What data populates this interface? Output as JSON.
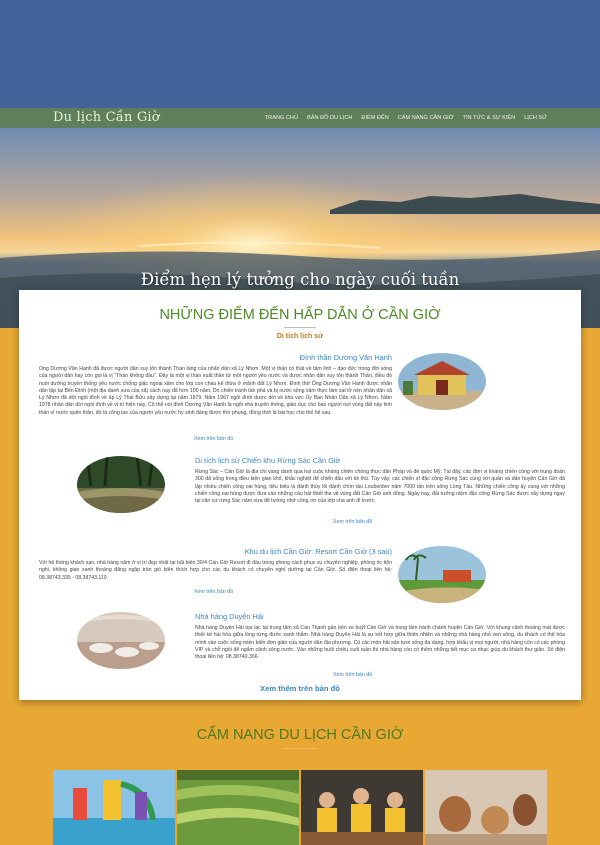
{
  "site": {
    "logo": "Du lịch Cần Giờ",
    "nav": [
      "TRANG CHỦ",
      "BẢN ĐỒ DU LỊCH",
      "ĐIỂM ĐẾN",
      "CẨM NANG CẦN GIỜ",
      "TIN TỨC & SỰ KIỆN",
      "LỊCH SỬ"
    ]
  },
  "hero": {
    "title": "Điểm hẹn lý tưởng cho ngày cuối tuần"
  },
  "destinations": {
    "title": "NHỮNG ĐIỂM ĐẾN HẤP DẪN Ở CẦN GIỜ",
    "subtitle": "Di tích lịch sử",
    "more": "Xem thêm trên bản đồ",
    "items": [
      {
        "title": "Đình thần Dương Văn Hạnh",
        "text": "Ông Dương Văn Hạnh đã được người dân suy tôn thành Thần làng của nhân dân xã Lý Nhơn. Một vị thần có thật về tâm linh – đạo đức trong đời sống của người dân hay còn gọi là vị \"Thần không đầu\". Đây là một vị thần xuất thân từ một người yêu nước và được nhân dân suy tôn thành Thần, điều đó nuôi dưỡng truyền thống yêu nước chống giặc ngoại xâm cho lớp con cháu kế thừa ở mảnh đất Lý Nhơn. Đình thờ Ông Dương Văn Hạnh được nhân dân lập tại Bến Đình (một địa danh xưa của xã) cách nay đã hơn 100 năm. Do chiến tranh tàn phá và bị nước sông xâm thực làm sạt lở nền nhân dân xã Lý Nhơn đã dời ngôi đình về ấp Lý Thái Bửu xây dựng lại năm 1879. Năm 1967 ngôi đình được dời về khu vực Ủy Ban Nhân Dân xã Lý Nhơn. Năm 1978 nhân dân dời ngôi đình về vị trí hiện nay. Cô thể nói đình Dương Văn Hạnh là ngôi nhà truyền thống, giáo dục cho bao người nơi vùng đất này tinh thần vì nước quên thân, đó là công lao của người yêu nước hy sinh đáng được thờ phụng, đồng thời là bài học cho thế hệ sau.",
        "more": "Xem trên bản đồ"
      },
      {
        "title": "Di tích lịch sử Chiến khu Rừng Sác Cần Giờ",
        "text": "Rừng Sác – Cần Giờ là địa chỉ vang danh qua hai cuộc kháng chiến chống thực dân Pháp và đế quốc Mỹ. Tại đây, các đơn vị kháng chiến cùng với trung đoàn 300 đã sống trong điều kiện gian khổ, khắc nghiệt để chiến đấu với kẻ thù. Tùy vậy, các chiến sĩ đặc công Rừng Sác cùng với quân và dân huyện Cần Giờ đã lập nhiều chiến công oai hùng, tiêu biểu là đánh thủy lôi đánh chìm tàu Loubenber năm 7000 tấn trên sông Lòng Tàu. Những chiến công ấy cùng với những chiến công oai hùng được đưa vào những câu hát thiết tha về vùng đất Cần Giờ anh dũng. Ngày nay, đài tưởng niệm đặc công Rừng Sác được xây dựng ngay tại căn cứ rừng Sác năm xưa để tưởng nhớ công ơn của lớp cha anh đi trước.",
        "more": "Xem trên bản đồ"
      },
      {
        "title": "Khu du lịch Cần Giờ: Resort Cần Giờ (3 sao)",
        "text": "Với hệ thống khách sạn, nhà hàng nằm ở vị trí đẹp nhất tại bãi biển 30/4 Cần Giờ Resort đi đầu trong phong cách phục vụ chuyên nghiệp, phòng ốc tiện nghi, không gian xanh thoáng đãng ngập tràn gió biển thích hợp cho các du khách có chuyến nghỉ dưỡng tại Cần Giờ. Số điện thoại liên hệ: 08.38743.335 - 08.38743.110",
        "more": "Xem trên bản đồ"
      },
      {
        "title": "Nhà hàng Duyên Hải",
        "text": "Nhà hàng Duyên Hải tọa lạc tại trung tâm xã Cần Thạnh gần bến xe buýt Cần Giờ và trung tâm hành chánh huyện Cần Giờ. Với khung cảnh thoáng mát được thiết kế hài hòa giữa lòng rừng đước xanh thẳm. Nhà hàng Duyên Hải là sự kết hợp giữa thiên nhiên và những nhà hàng nhỏ ven sông, du khách có thể hòa mình vào cuộc sống miền biển đơn giản của người dân địa phương. Có các món hải sản tươi sống đa dạng, hợp khẩu vị mọi người, nhà hàng còn có các phòng VIP và chỗ ngồi để ngắm cảnh sông nước. Vào những buổi chiều cuối tuần thì nhà hàng còn có thêm những tiết mục ca nhạc giúp du khách thư giãn. Số điện thoại liên hệ: 08.38740.366",
        "more": "Xem trên bản đồ"
      }
    ]
  },
  "handbook": {
    "title": "CẨM NANG DU LỊCH CẦN GIỜ"
  },
  "colors": {
    "header": "#44639a",
    "nav": "#46786a",
    "body": "#e9a833",
    "accent_green": "#4d8a25",
    "link": "#3d85c6"
  }
}
